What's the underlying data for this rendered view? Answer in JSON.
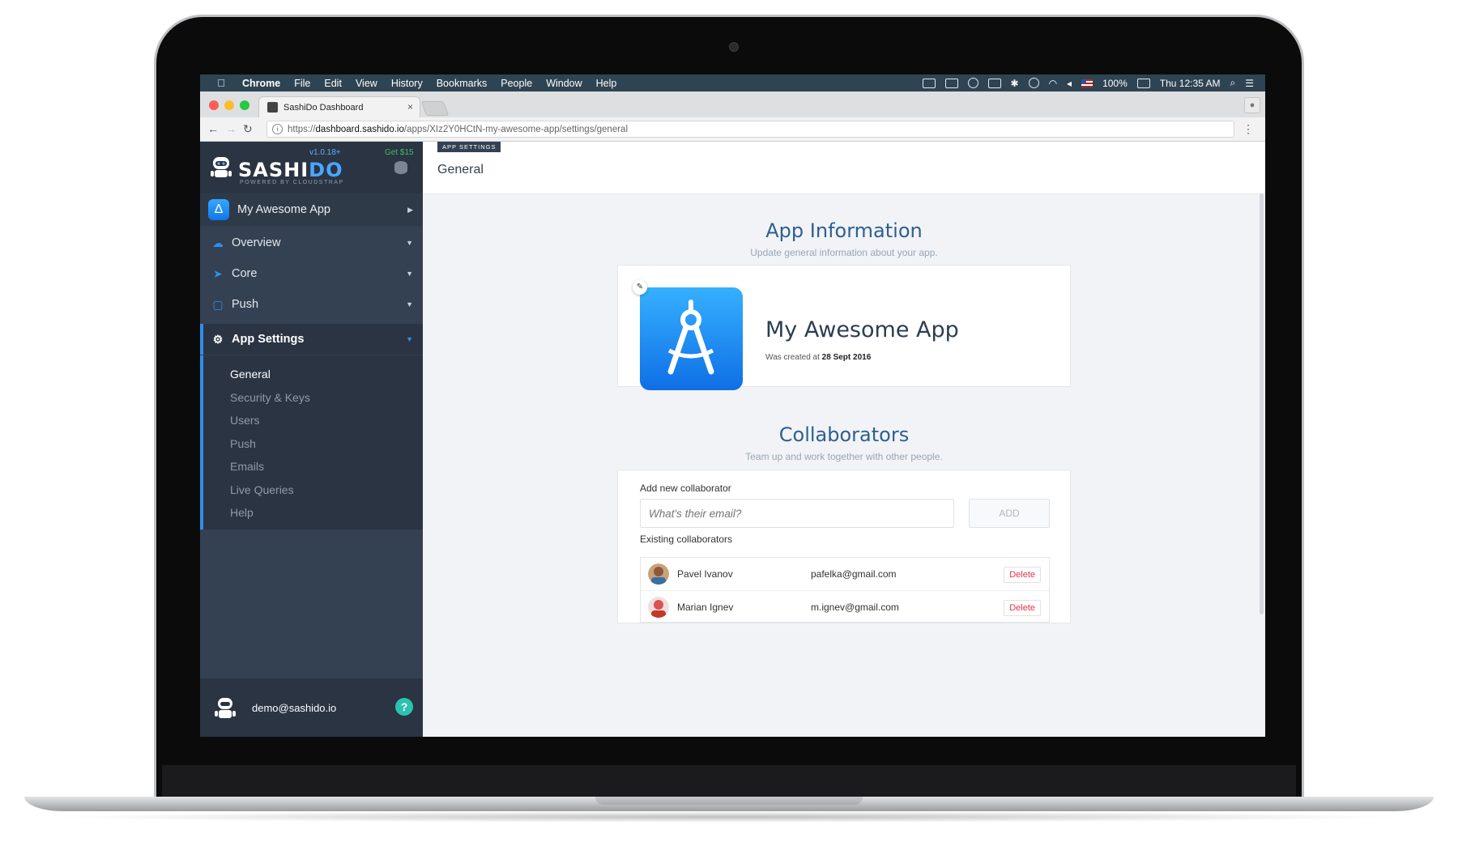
{
  "menubar": {
    "app": "Chrome",
    "items": [
      "File",
      "Edit",
      "View",
      "History",
      "Bookmarks",
      "People",
      "Window",
      "Help"
    ],
    "battery": "100%",
    "clock": "Thu 12:35 AM"
  },
  "browser": {
    "tab_title": "SashiDo Dashboard",
    "tab_close": "×",
    "url_prefix": "https://",
    "url_host": "dashboard.sashido.io",
    "url_path": "/apps/XIz2Y0HCtN-my-awesome-app/settings/general"
  },
  "sidebar": {
    "brand_main": "SASHI",
    "brand_accent": "DO",
    "version": "v1.0.18+",
    "powered_by": "POWERED BY CLOUDSTRAP",
    "promo": "Get $15",
    "current_app": "My Awesome App",
    "nav": [
      {
        "label": "Overview",
        "icon": "cloud-icon"
      },
      {
        "label": "Core",
        "icon": "rocket-icon"
      },
      {
        "label": "Push",
        "icon": "push-icon"
      },
      {
        "label": "App Settings",
        "icon": "gears-icon"
      }
    ],
    "submenu": [
      "General",
      "Security & Keys",
      "Users",
      "Push",
      "Emails",
      "Live Queries",
      "Help"
    ],
    "account_email": "demo@sashido.io",
    "help_label": "?"
  },
  "header": {
    "crumb": "APP SETTINGS",
    "title": "General"
  },
  "app_info": {
    "title": "App Information",
    "subtitle": "Update general information about your app.",
    "app_name": "My Awesome App",
    "created_prefix": "Was created at",
    "created_date": "28 Sept 2016"
  },
  "collaborators": {
    "title": "Collaborators",
    "subtitle": "Team up and work together with other people.",
    "add_label": "Add new collaborator",
    "email_placeholder": "What's their email?",
    "add_button": "ADD",
    "existing_label": "Existing collaborators",
    "list": [
      {
        "name": "Pavel Ivanov",
        "email": "pafelka@gmail.com",
        "action": "Delete"
      },
      {
        "name": "Marian Ignev",
        "email": "m.ignev@gmail.com",
        "action": "Delete"
      }
    ]
  },
  "colors": {
    "sidebar": "#344152",
    "accent": "#2f8fe8",
    "title_blue": "#2f5f8f",
    "delete_red": "#e0334d",
    "help_teal": "#2bc2b0"
  }
}
